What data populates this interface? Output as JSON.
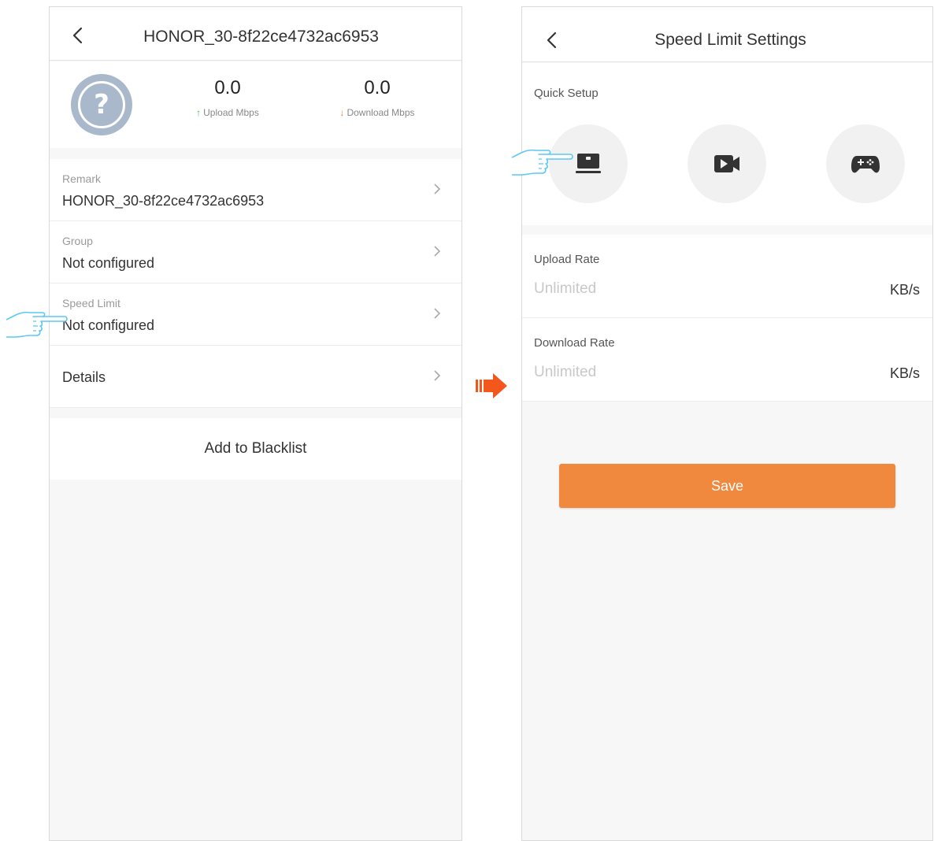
{
  "left_screen": {
    "title": "HONOR_30-8f22ce4732ac6953",
    "avatar": {
      "icon": "question-mark-icon",
      "glyph": "?"
    },
    "upload": {
      "value": "0.0",
      "label": "Upload Mbps",
      "arrow": "↑"
    },
    "download": {
      "value": "0.0",
      "label": "Download Mbps",
      "arrow": "↓"
    },
    "rows": [
      {
        "label": "Remark",
        "value": "HONOR_30-8f22ce4732ac6953"
      },
      {
        "label": "Group",
        "value": "Not configured"
      },
      {
        "label": "Speed Limit",
        "value": "Not configured"
      },
      {
        "label": "Details"
      }
    ],
    "blacklist_label": "Add to Blacklist"
  },
  "right_screen": {
    "title": "Speed Limit Settings",
    "quick_setup": {
      "label": "Quick Setup",
      "options": [
        {
          "icon": "laptop-icon"
        },
        {
          "icon": "video-camera-icon"
        },
        {
          "icon": "gamepad-icon"
        }
      ]
    },
    "upload_rate": {
      "label": "Upload Rate",
      "placeholder": "Unlimited",
      "unit": "KB/s"
    },
    "download_rate": {
      "label": "Download Rate",
      "placeholder": "Unlimited",
      "unit": "KB/s"
    },
    "save_label": "Save"
  },
  "colors": {
    "accent": "#f0883e",
    "flow_arrow": "#f4571c",
    "pointer_outline": "#5bc8f5",
    "upload_arrow": "#3cbf5a",
    "download_arrow": "#f0803a",
    "avatar": "#a9b9cb"
  }
}
